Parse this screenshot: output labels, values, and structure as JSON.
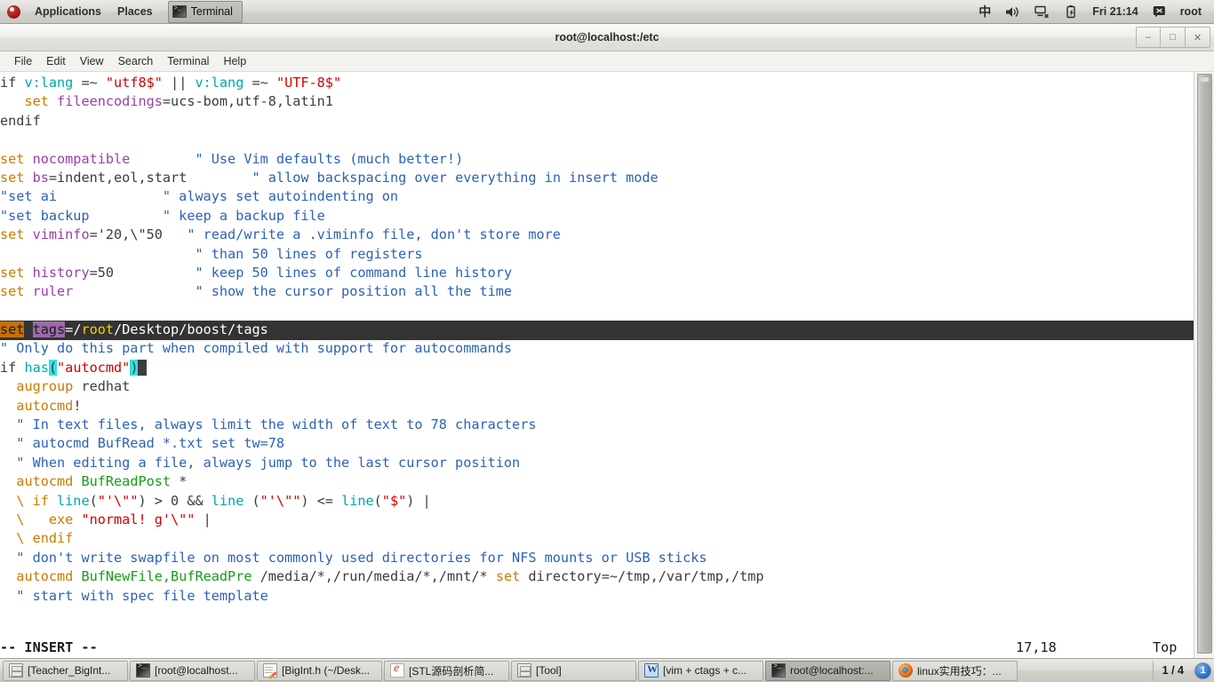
{
  "top_panel": {
    "logo_icon": "fedora-logo-icon",
    "menus": [
      {
        "label": "Applications"
      },
      {
        "label": "Places"
      }
    ],
    "window_button": {
      "label": "Terminal",
      "icon": "terminal-icon"
    },
    "tray": {
      "input_method": "中",
      "volume_icon": "volume-icon",
      "network_icon": "network-disconnected-icon",
      "battery_icon": "battery-charging-icon",
      "clock": "Fri 21:14",
      "user_icon": "user-icon",
      "user": "root"
    }
  },
  "window": {
    "title": "root@localhost:/etc",
    "controls": {
      "minimize": "–",
      "maximize": "□",
      "close": "✕"
    },
    "menubar": [
      "File",
      "Edit",
      "View",
      "Search",
      "Terminal",
      "Help"
    ]
  },
  "terminal": {
    "lines": [
      {
        "id": "l1",
        "segs": [
          {
            "t": "if ",
            "c": "plain"
          },
          {
            "t": "v:lang",
            "c": "func"
          },
          {
            "t": " =~ ",
            "c": "plain"
          },
          {
            "t": "\"utf8$\"",
            "c": "str"
          },
          {
            "t": " || ",
            "c": "plain"
          },
          {
            "t": "v:lang",
            "c": "func"
          },
          {
            "t": " =~ ",
            "c": "plain"
          },
          {
            "t": "\"UTF-8$\"",
            "c": "str"
          }
        ]
      },
      {
        "id": "l2",
        "segs": [
          {
            "t": "   ",
            "c": "plain"
          },
          {
            "t": "set",
            "c": "set"
          },
          {
            "t": " ",
            "c": "plain"
          },
          {
            "t": "fileencodings",
            "c": "opt"
          },
          {
            "t": "=ucs-bom,utf-8,latin1",
            "c": "plain"
          }
        ]
      },
      {
        "id": "l3",
        "segs": [
          {
            "t": "endif",
            "c": "plain"
          }
        ]
      },
      {
        "id": "l4",
        "segs": [
          {
            "t": "",
            "c": "plain"
          }
        ]
      },
      {
        "id": "l5",
        "segs": [
          {
            "t": "set",
            "c": "set"
          },
          {
            "t": " ",
            "c": "plain"
          },
          {
            "t": "nocompatible",
            "c": "opt"
          },
          {
            "t": "        ",
            "c": "plain"
          },
          {
            "t": "\" Use Vim defaults (much better!)",
            "c": "cmt"
          }
        ]
      },
      {
        "id": "l6",
        "segs": [
          {
            "t": "set",
            "c": "set"
          },
          {
            "t": " ",
            "c": "plain"
          },
          {
            "t": "bs",
            "c": "opt"
          },
          {
            "t": "=indent,eol,start",
            "c": "plain"
          },
          {
            "t": "        ",
            "c": "plain"
          },
          {
            "t": "\" allow backspacing over everything in insert mode",
            "c": "cmt"
          }
        ]
      },
      {
        "id": "l7",
        "segs": [
          {
            "t": "\"set ai",
            "c": "cmt"
          },
          {
            "t": "             ",
            "c": "plain"
          },
          {
            "t": "\" always set autoindenting on",
            "c": "cmt"
          }
        ]
      },
      {
        "id": "l8",
        "segs": [
          {
            "t": "\"set backup",
            "c": "cmt"
          },
          {
            "t": "         ",
            "c": "plain"
          },
          {
            "t": "\" keep a backup file",
            "c": "cmt"
          }
        ]
      },
      {
        "id": "l9",
        "segs": [
          {
            "t": "set",
            "c": "set"
          },
          {
            "t": " ",
            "c": "plain"
          },
          {
            "t": "viminfo",
            "c": "opt"
          },
          {
            "t": "='20,\\\"50",
            "c": "plain"
          },
          {
            "t": "   ",
            "c": "plain"
          },
          {
            "t": "\" read/write a .viminfo file, don't store more",
            "c": "cmt"
          }
        ]
      },
      {
        "id": "l10",
        "segs": [
          {
            "t": "                        ",
            "c": "plain"
          },
          {
            "t": "\" than 50 lines of registers",
            "c": "cmt"
          }
        ]
      },
      {
        "id": "l11",
        "segs": [
          {
            "t": "set",
            "c": "set"
          },
          {
            "t": " ",
            "c": "plain"
          },
          {
            "t": "history",
            "c": "opt"
          },
          {
            "t": "=50",
            "c": "plain"
          },
          {
            "t": "          ",
            "c": "plain"
          },
          {
            "t": "\" keep 50 lines of command line history",
            "c": "cmt"
          }
        ]
      },
      {
        "id": "l12",
        "segs": [
          {
            "t": "set",
            "c": "set"
          },
          {
            "t": " ",
            "c": "plain"
          },
          {
            "t": "ruler",
            "c": "opt"
          },
          {
            "t": "               ",
            "c": "plain"
          },
          {
            "t": "\" show the cursor position all the time",
            "c": "cmt"
          }
        ]
      },
      {
        "id": "l13",
        "segs": [
          {
            "t": "",
            "c": "plain"
          }
        ]
      },
      {
        "id": "l15",
        "segs": [
          {
            "t": "",
            "c": "plain"
          }
        ]
      },
      {
        "id": "l16",
        "segs": [
          {
            "t": "\" Only do this part when compiled with support for autocommands",
            "c": "cmt"
          }
        ]
      },
      {
        "id": "l17",
        "segs": [
          {
            "t": "if ",
            "c": "plain"
          },
          {
            "t": "has",
            "c": "func"
          },
          {
            "t": "(",
            "c": "paren"
          },
          {
            "t": "\"autocmd\"",
            "c": "str"
          },
          {
            "t": ")",
            "c": "paren"
          },
          {
            "t": " ",
            "c": "cursor"
          }
        ]
      },
      {
        "id": "l18",
        "segs": [
          {
            "t": "  ",
            "c": "plain"
          },
          {
            "t": "augroup",
            "c": "set"
          },
          {
            "t": " redhat",
            "c": "plain"
          }
        ]
      },
      {
        "id": "l19",
        "segs": [
          {
            "t": "  ",
            "c": "plain"
          },
          {
            "t": "autocmd",
            "c": "set"
          },
          {
            "t": "!",
            "c": "plain"
          }
        ]
      },
      {
        "id": "l20",
        "segs": [
          {
            "t": "  ",
            "c": "plain"
          },
          {
            "t": "\" In text files, always limit the width of text to 78 characters",
            "c": "cmt"
          }
        ]
      },
      {
        "id": "l21",
        "segs": [
          {
            "t": "  ",
            "c": "plain"
          },
          {
            "t": "\" autocmd BufRead *.txt set tw=78",
            "c": "cmt"
          }
        ]
      },
      {
        "id": "l22",
        "segs": [
          {
            "t": "  ",
            "c": "plain"
          },
          {
            "t": "\" When editing a file, always jump to the last cursor position",
            "c": "cmt"
          }
        ]
      },
      {
        "id": "l23",
        "segs": [
          {
            "t": "  ",
            "c": "plain"
          },
          {
            "t": "autocmd",
            "c": "set"
          },
          {
            "t": " ",
            "c": "plain"
          },
          {
            "t": "BufReadPost",
            "c": "grn"
          },
          {
            "t": " *",
            "c": "plain"
          }
        ]
      },
      {
        "id": "l24",
        "segs": [
          {
            "t": "  \\ if ",
            "c": "set"
          },
          {
            "t": "line",
            "c": "func"
          },
          {
            "t": "(",
            "c": "plain"
          },
          {
            "t": "\"'\\\"\"",
            "c": "str"
          },
          {
            "t": ") > 0 && ",
            "c": "plain"
          },
          {
            "t": "line",
            "c": "func"
          },
          {
            "t": " (",
            "c": "plain"
          },
          {
            "t": "\"'\\\"\"",
            "c": "str"
          },
          {
            "t": ") <= ",
            "c": "plain"
          },
          {
            "t": "line",
            "c": "func"
          },
          {
            "t": "(",
            "c": "plain"
          },
          {
            "t": "\"$\"",
            "c": "str"
          },
          {
            "t": ") |",
            "c": "plain"
          }
        ]
      },
      {
        "id": "l25",
        "segs": [
          {
            "t": "  \\   exe ",
            "c": "set"
          },
          {
            "t": "\"normal! g'\\\"\"",
            "c": "str"
          },
          {
            "t": " |",
            "c": "plain"
          }
        ]
      },
      {
        "id": "l26",
        "segs": [
          {
            "t": "  \\ endif",
            "c": "set"
          }
        ]
      },
      {
        "id": "l27",
        "segs": [
          {
            "t": "  ",
            "c": "plain"
          },
          {
            "t": "\" don't write swapfile on most commonly used directories for NFS mounts or USB sticks",
            "c": "cmt"
          }
        ]
      },
      {
        "id": "l28",
        "segs": [
          {
            "t": "  ",
            "c": "plain"
          },
          {
            "t": "autocmd",
            "c": "set"
          },
          {
            "t": " ",
            "c": "plain"
          },
          {
            "t": "BufNewFile,BufReadPre",
            "c": "grn"
          },
          {
            "t": " /media/*,/run/media/*,/mnt/* ",
            "c": "plain"
          },
          {
            "t": "set",
            "c": "set"
          },
          {
            "t": " ",
            "c": "plain"
          },
          {
            "t": "directory",
            "c": "plain"
          },
          {
            "t": "=~/tmp,/var/tmp,/tmp",
            "c": "plain"
          }
        ]
      },
      {
        "id": "l29",
        "segs": [
          {
            "t": "  ",
            "c": "plain"
          },
          {
            "t": "\" start with spec file template",
            "c": "cmt"
          }
        ]
      }
    ],
    "highlighted_line": {
      "set_kw": "set",
      "space": " ",
      "option": "tags",
      "eq": "=/",
      "root": "root",
      "rest": "/Desktop/boost/tags"
    },
    "status": {
      "mode": "-- INSERT --",
      "ruler": "17,18",
      "position": "Top"
    }
  },
  "taskbar": {
    "items": [
      {
        "label": "[Teacher_BigInt...",
        "icon": "archive-icon",
        "active": false
      },
      {
        "label": "[root@localhost...",
        "icon": "terminal-icon",
        "active": false
      },
      {
        "label": "[BigInt.h (~/Desk...",
        "icon": "text-editor-icon",
        "active": false
      },
      {
        "label": "[STL源码剖析简...",
        "icon": "pdf-reader-icon",
        "active": false
      },
      {
        "label": "[Tool]",
        "icon": "archive-icon",
        "active": false
      },
      {
        "label": "[vim + ctags + c...",
        "icon": "word-document-icon",
        "active": false
      },
      {
        "label": "root@localhost:...",
        "icon": "terminal-icon",
        "active": true
      },
      {
        "label": "linux实用技巧：...",
        "icon": "firefox-icon",
        "active": false
      }
    ],
    "pager": "1 / 4",
    "workspace_badge": "1"
  }
}
